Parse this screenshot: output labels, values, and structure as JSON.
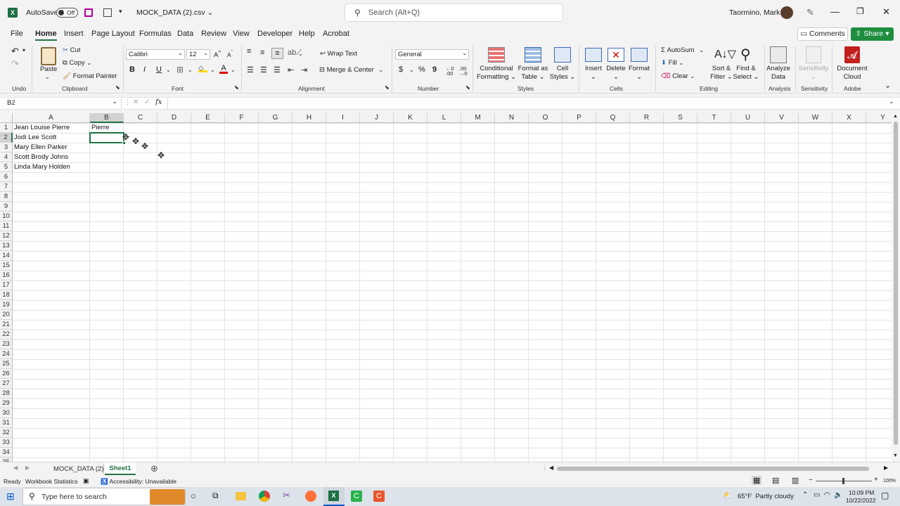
{
  "titlebar": {
    "autosave_label": "AutoSave",
    "autosave_state": "Off",
    "filename": "MOCK_DATA (2).csv",
    "search_placeholder": "Search (Alt+Q)",
    "user": "Taormino, Mark"
  },
  "tabs": [
    "File",
    "Home",
    "Insert",
    "Page Layout",
    "Formulas",
    "Data",
    "Review",
    "View",
    "Developer",
    "Help",
    "Acrobat"
  ],
  "active_tab": "Home",
  "comments_label": "Comments",
  "share_label": "Share",
  "ribbon": {
    "undo_group": "Undo",
    "clipboard": {
      "paste": "Paste",
      "cut": "Cut",
      "copy": "Copy",
      "format_painter": "Format Painter",
      "group": "Clipboard"
    },
    "font": {
      "name": "Calibri",
      "size": "12",
      "group": "Font",
      "bold": "B",
      "italic": "I",
      "underline": "U"
    },
    "alignment": {
      "wrap": "Wrap Text",
      "merge": "Merge & Center",
      "group": "Alignment"
    },
    "number": {
      "format": "General",
      "currency": "$",
      "percent": "%",
      "comma": "9",
      "group": "Number"
    },
    "styles": {
      "cond1": "Conditional",
      "cond2": "Formatting",
      "fmt1": "Format as",
      "fmt2": "Table",
      "cell1": "Cell",
      "cell2": "Styles",
      "group": "Styles"
    },
    "cells": {
      "insert": "Insert",
      "delete": "Delete",
      "format": "Format",
      "group": "Cells"
    },
    "editing": {
      "autosum": "AutoSum",
      "fill": "Fill",
      "clear": "Clear",
      "sort1": "Sort &",
      "sort2": "Filter",
      "find1": "Find &",
      "find2": "Select",
      "group": "Editing"
    },
    "analysis": {
      "btn1": "Analyze",
      "btn2": "Data",
      "group": "Analysis"
    },
    "sensitivity": {
      "btn": "Sensitivity",
      "group": "Sensitivity"
    },
    "adobe": {
      "btn1": "Document",
      "btn2": "Cloud",
      "group": "Adobe"
    }
  },
  "formula_bar": {
    "name_box": "B2",
    "fx": "fx",
    "value": ""
  },
  "columns": [
    "A",
    "B",
    "C",
    "D",
    "E",
    "F",
    "G",
    "H",
    "I",
    "J",
    "K",
    "L",
    "M",
    "N",
    "O",
    "P",
    "Q",
    "R",
    "S",
    "T",
    "U",
    "V",
    "W",
    "X",
    "Y"
  ],
  "rows": [
    "1",
    "2",
    "3",
    "4",
    "5",
    "6",
    "7",
    "8",
    "9",
    "10",
    "11",
    "12",
    "13",
    "14",
    "15",
    "16",
    "17",
    "18",
    "19",
    "20",
    "21",
    "22",
    "23",
    "24",
    "25",
    "26",
    "27",
    "28",
    "29",
    "30",
    "31",
    "32",
    "33",
    "34",
    "35"
  ],
  "cells": {
    "A1": "Jean Louise Pierre",
    "B1": "Pierre",
    "A2": "Jodi Lee Scott",
    "A3": "Mary Ellen Parker",
    "A4": "Scott Brody Johns",
    "A5": "Linda Mary Holden"
  },
  "sheets": [
    "MOCK_DATA (2)",
    "Sheet1"
  ],
  "active_sheet": "Sheet1",
  "status": {
    "ready": "Ready",
    "workbook_stats": "Workbook Statistics",
    "accessibility": "Accessibility: Unavailable",
    "zoom": "100%"
  },
  "taskbar": {
    "search_placeholder": "Type here to search",
    "weather": "65°F  Partly cloudy",
    "time": "10:09 PM",
    "date": "10/22/2022"
  },
  "colors": {
    "excel_green": "#217346",
    "share_green": "#1e8e3e",
    "selection": "#217346"
  }
}
